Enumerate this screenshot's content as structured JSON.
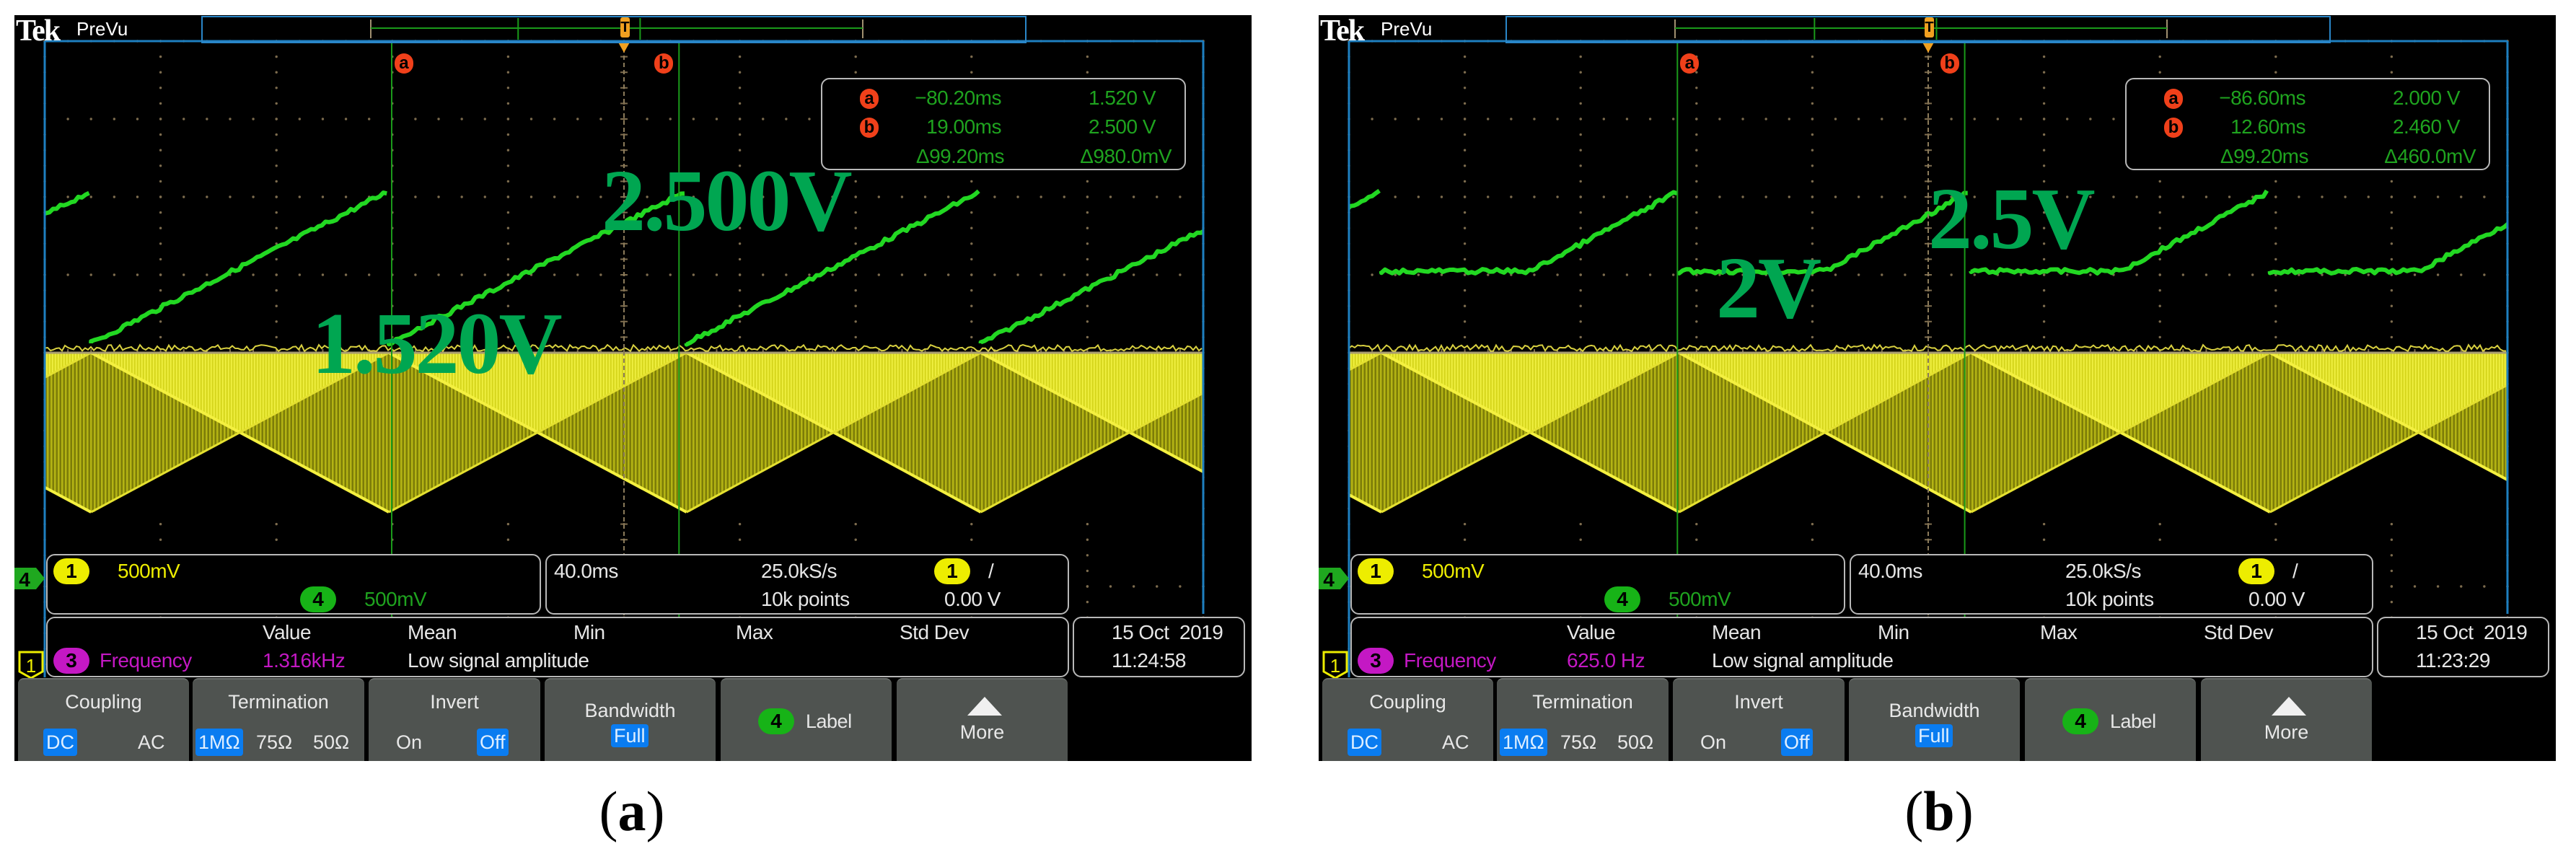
{
  "colors": {
    "ch1_yellow": "#eded00",
    "ch4_green": "#22d822",
    "math_magenta": "#c418c4",
    "cursor_orange": "#f0401a",
    "selected_blue": "#0a7cf0",
    "annotation_green": "#00a651"
  },
  "panels": [
    {
      "caption_letter": "a",
      "brand": "Tek",
      "mode": "PreVu",
      "markers": {
        "ch4": "4",
        "ch1": "1",
        "trigger": "T"
      },
      "cursor_positions_ms": {
        "a": -80.2,
        "b": 19.0,
        "time_per_div": 40.0
      },
      "cursor_readout": {
        "a_label": "a",
        "b_label": "b",
        "a_time": "−80.20ms",
        "a_value": "1.520 V",
        "b_time": "19.00ms",
        "b_value": "2.500 V",
        "delta_time": "Δ99.20ms",
        "delta_value": "Δ980.0mV"
      },
      "annotations": {
        "value_a": "1.520V",
        "value_b": "2.500V"
      },
      "channels": {
        "ch1_badge": "1",
        "ch1_scale": "500mV",
        "ch4_badge": "4",
        "ch4_scale": "500mV"
      },
      "timebase": {
        "time_per_div": "40.0ms",
        "sample_rate": "25.0kS/s",
        "record_length": "10k points",
        "trigger_source": "1",
        "trigger_slope": "/",
        "trigger_level": "0.00 V"
      },
      "measurements": {
        "headers": [
          "Value",
          "Mean",
          "Min",
          "Max",
          "Std Dev"
        ],
        "source_badge": "3",
        "name": "Frequency",
        "value": "1.316kHz",
        "status": "Low signal amplitude"
      },
      "datetime": {
        "date": "15 Oct  2019",
        "time": "11:24:58"
      },
      "menu": {
        "coupling": {
          "title": "Coupling",
          "options": [
            "DC",
            "AC"
          ]
        },
        "termination": {
          "title": "Termination",
          "options": [
            "1MΩ",
            "75Ω",
            "50Ω"
          ]
        },
        "invert": {
          "title": "Invert",
          "options": [
            "On",
            "Off"
          ]
        },
        "bandwidth": {
          "title": "Bandwidth",
          "value": "Full"
        },
        "label": {
          "badge": "4",
          "title": "Label"
        },
        "more": {
          "title": "More"
        }
      }
    },
    {
      "caption_letter": "b",
      "brand": "Tek",
      "mode": "PreVu",
      "markers": {
        "ch4": "4",
        "ch1": "1",
        "trigger": "T"
      },
      "cursor_positions_ms": {
        "a": -86.6,
        "b": 12.6,
        "time_per_div": 40.0
      },
      "cursor_readout": {
        "a_label": "a",
        "b_label": "b",
        "a_time": "−86.60ms",
        "a_value": "2.000 V",
        "b_time": "12.60ms",
        "b_value": "2.460 V",
        "delta_time": "Δ99.20ms",
        "delta_value": "Δ460.0mV"
      },
      "annotations": {
        "value_a": "2V",
        "value_b": "2.5V"
      },
      "channels": {
        "ch1_badge": "1",
        "ch1_scale": "500mV",
        "ch4_badge": "4",
        "ch4_scale": "500mV"
      },
      "timebase": {
        "time_per_div": "40.0ms",
        "sample_rate": "25.0kS/s",
        "record_length": "10k points",
        "trigger_source": "1",
        "trigger_slope": "/",
        "trigger_level": "0.00 V"
      },
      "measurements": {
        "headers": [
          "Value",
          "Mean",
          "Min",
          "Max",
          "Std Dev"
        ],
        "source_badge": "3",
        "name": "Frequency",
        "value": "625.0 Hz",
        "status": "Low signal amplitude"
      },
      "datetime": {
        "date": "15 Oct  2019",
        "time": "11:23:29"
      },
      "menu": {
        "coupling": {
          "title": "Coupling",
          "options": [
            "DC",
            "AC"
          ]
        },
        "termination": {
          "title": "Termination",
          "options": [
            "1MΩ",
            "75Ω",
            "50Ω"
          ]
        },
        "invert": {
          "title": "Invert",
          "options": [
            "On",
            "Off"
          ]
        },
        "bandwidth": {
          "title": "Bandwidth",
          "value": "Full"
        },
        "label": {
          "badge": "4",
          "title": "Label"
        },
        "more": {
          "title": "More"
        }
      }
    }
  ]
}
